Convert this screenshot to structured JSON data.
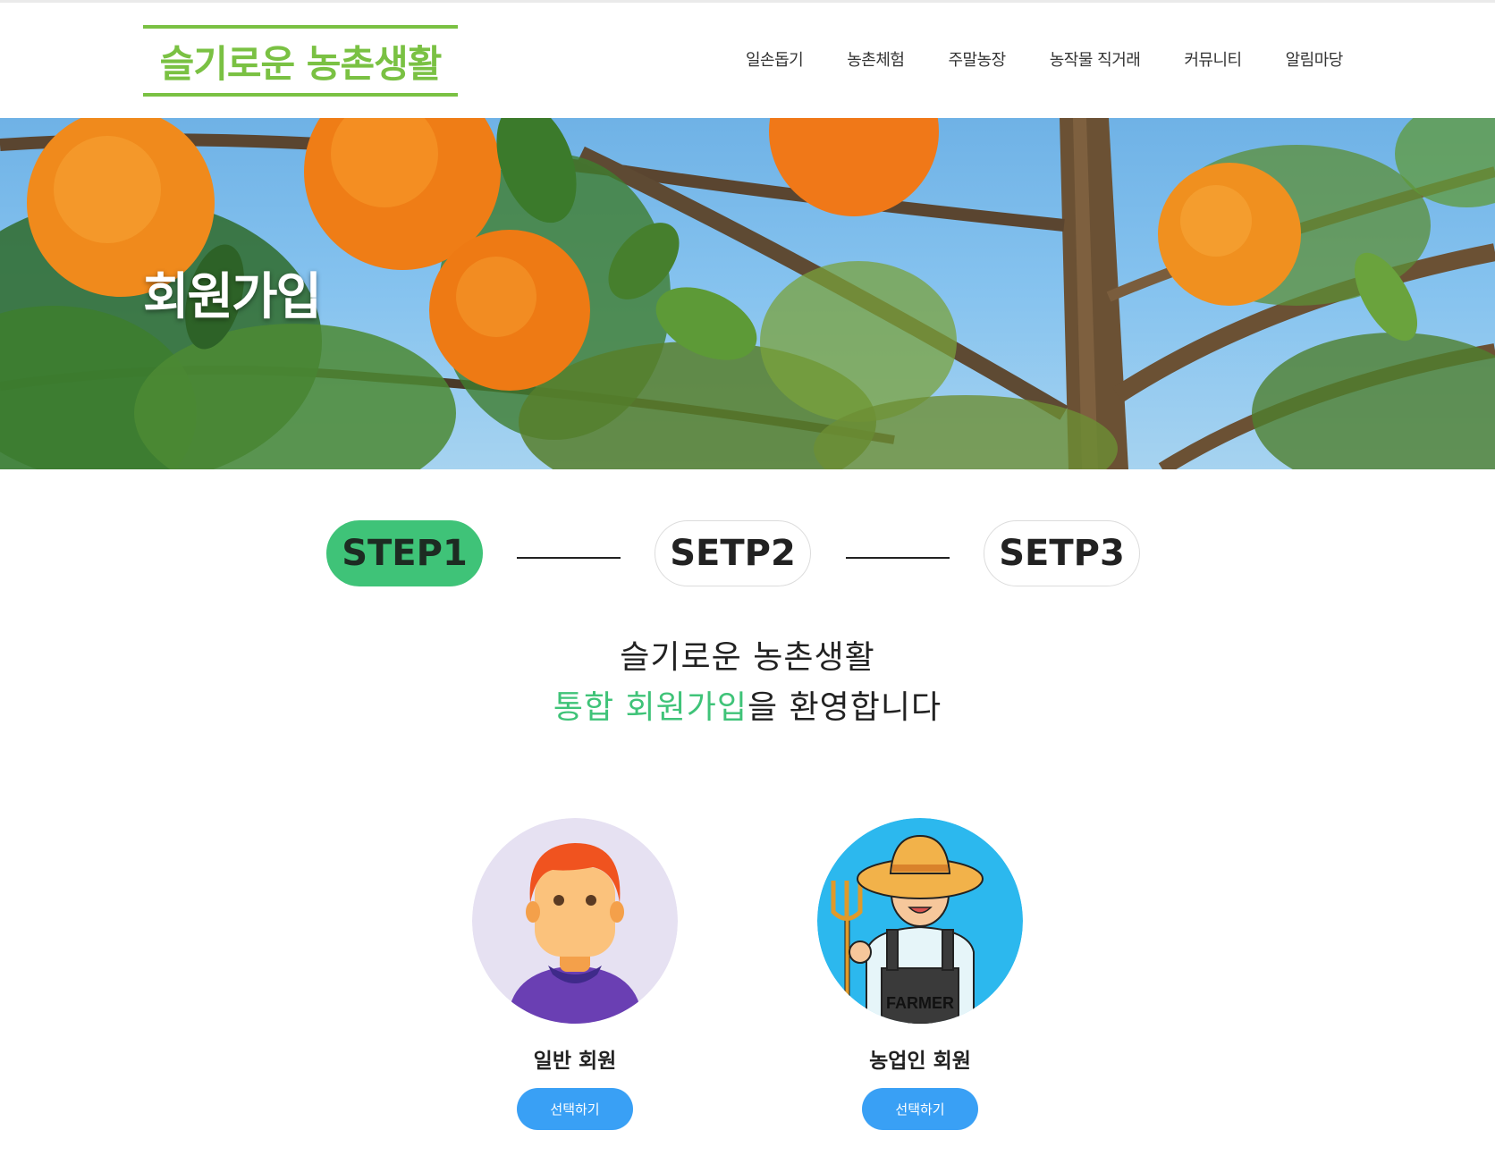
{
  "header": {
    "logo_text": "슬기로운 농촌생활",
    "nav": [
      "일손돕기",
      "농촌체험",
      "주말농장",
      "농작물 직거래",
      "커뮤니티",
      "알림마당"
    ]
  },
  "hero": {
    "title": "회원가입"
  },
  "steps": [
    "STEP1",
    "SETP2",
    "SETP3"
  ],
  "welcome": {
    "line1": "슬기로운 농촌생활",
    "line2_highlight": "통합 회원가입",
    "line2_rest": "을 환영합니다"
  },
  "members": [
    {
      "label": "일반 회원",
      "button": "선택하기",
      "avatar": "person-avatar"
    },
    {
      "label": "농업인 회원",
      "button": "선택하기",
      "avatar": "farmer-avatar",
      "badge": "FARMER"
    }
  ],
  "colors": {
    "logo_green": "#7ac143",
    "step_active": "#3fc378",
    "button_blue": "#39a0f5",
    "highlight_green": "#3fc378"
  }
}
